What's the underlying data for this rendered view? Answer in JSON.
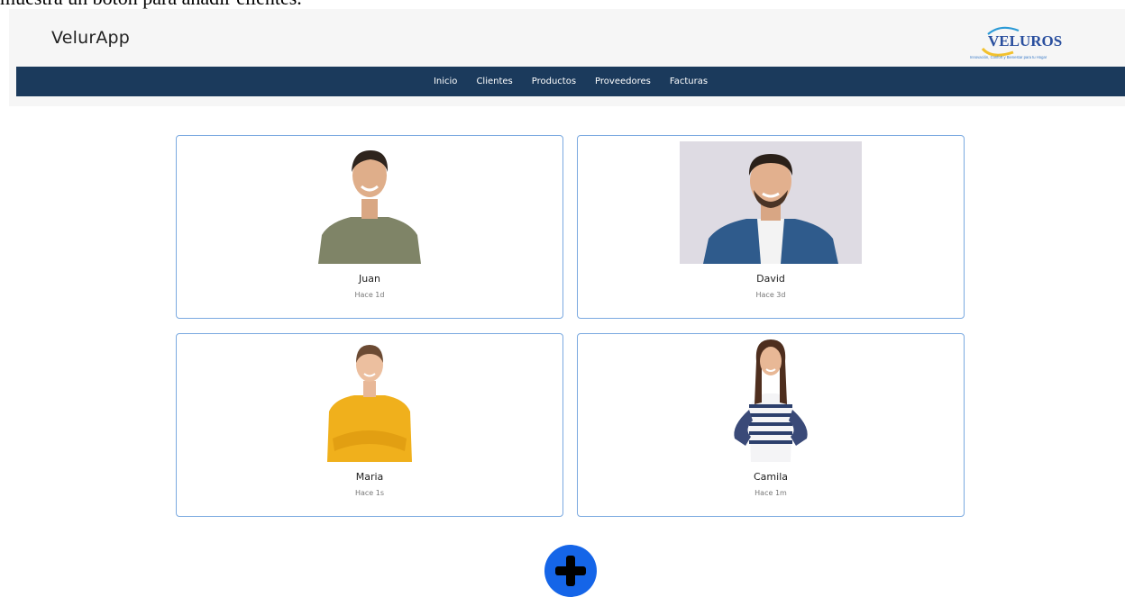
{
  "page_caption": "muestra un botón para añadir clientes.",
  "app": {
    "brand": "VelurApp"
  },
  "logo": {
    "text": "VELUROS",
    "tagline": "Innovación, Confort y Bienestar para tu Hogar"
  },
  "nav": {
    "items": [
      "Inicio",
      "Clientes",
      "Productos",
      "Proveedores",
      "Facturas"
    ]
  },
  "clients": [
    {
      "name": "Juan",
      "time": "Hace 1d"
    },
    {
      "name": "David",
      "time": "Hace 3d"
    },
    {
      "name": "Maria",
      "time": "Hace 1s"
    },
    {
      "name": "Camila",
      "time": "Hace 1m"
    }
  ],
  "colors": {
    "navbar": "#1b3a5c",
    "card_border": "#7aa9e0",
    "add_button": "#1565e8"
  },
  "icons": {
    "add": "plus-icon"
  }
}
